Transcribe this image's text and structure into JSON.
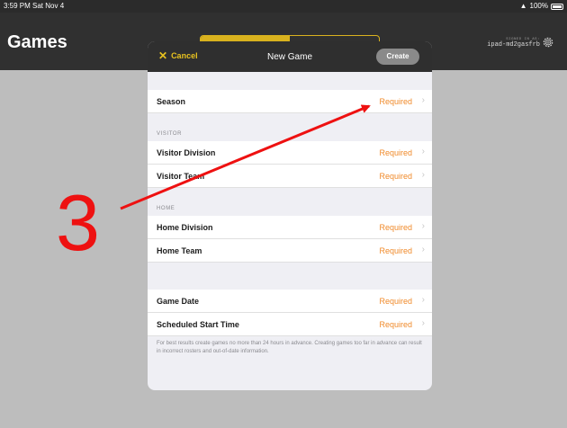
{
  "status_bar": {
    "time": "3:59 PM  Sat Nov 4",
    "battery": "100%"
  },
  "app": {
    "title": "Games"
  },
  "segmented": {
    "options": [
      "",
      ""
    ]
  },
  "signed_in": {
    "label": "SIGNED IN AS:",
    "device": "ipad-md2gasfrb"
  },
  "modal": {
    "cancel_label": "Cancel",
    "title": "New Game",
    "create_label": "Create",
    "season": {
      "label": "Season",
      "value": "Required"
    },
    "visitor_header": "VISITOR",
    "visitor_division": {
      "label": "Visitor Division",
      "value": "Required"
    },
    "visitor_team": {
      "label": "Visitor Team",
      "value": "Required"
    },
    "home_header": "HOME",
    "home_division": {
      "label": "Home Division",
      "value": "Required"
    },
    "home_team": {
      "label": "Home Team",
      "value": "Required"
    },
    "game_date": {
      "label": "Game Date",
      "value": "Required"
    },
    "start_time": {
      "label": "Scheduled Start Time",
      "value": "Required"
    },
    "footer_note": "For best results create games no more than 24 hours in advance. Creating games too far in advance can result in incorrect rosters and out-of-date information."
  },
  "annotation": {
    "step_number": "3",
    "color": "#ee1111"
  },
  "colors": {
    "accent": "#e8c21f",
    "required": "#f08a2a",
    "header_bg": "#2f2f2f"
  }
}
